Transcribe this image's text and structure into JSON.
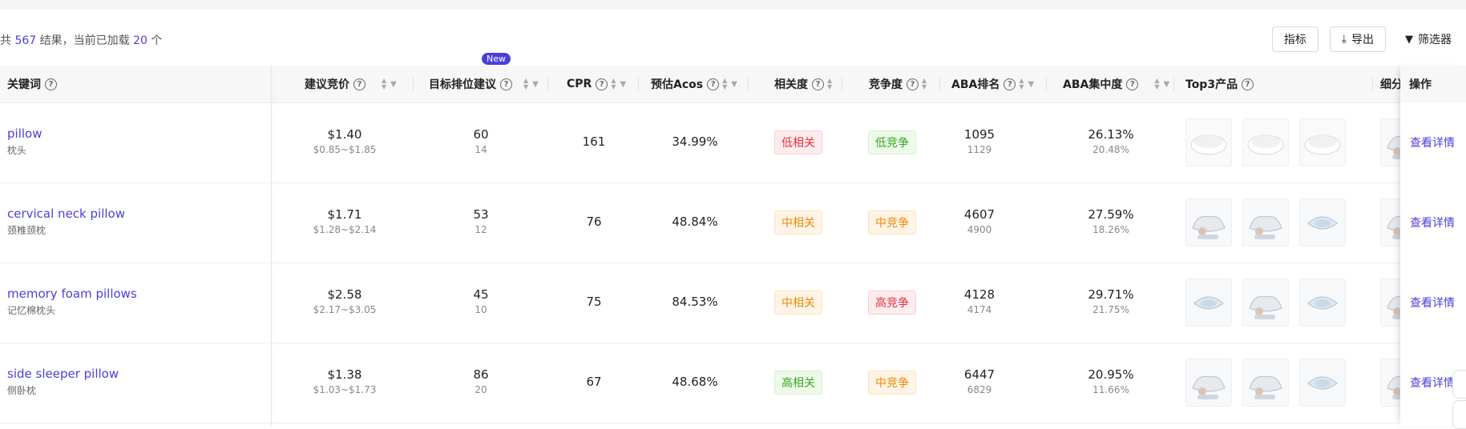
{
  "summary": {
    "prefix": "共",
    "total": "567",
    "middle": "结果，当前已加载",
    "loaded": "20",
    "suffix": "个"
  },
  "toolbar": {
    "metrics_label": "指标",
    "export_label": "导出",
    "filter_label": "筛选器"
  },
  "columns": {
    "keyword": "关键词",
    "bid": "建议竞价",
    "target_rank": "目标排位建议",
    "new_badge": "New",
    "cpr": "CPR",
    "acos": "预估Acos",
    "relevance": "相关度",
    "competition": "竞争度",
    "aba_rank": "ABA排名",
    "aba_conc": "ABA集中度",
    "top3": "Top3产品",
    "segment": "细分",
    "action": "操作"
  },
  "rows": [
    {
      "kw_en": "pillow",
      "kw_cn": "枕头",
      "bid": "$1.40",
      "bid_range": "$0.85~$1.85",
      "rank": "60",
      "rank_sub": "14",
      "cpr": "161",
      "acos": "34.99%",
      "relevance": "低相关",
      "relevance_level": "low-rel",
      "competition": "低竞争",
      "competition_level": "low-comp",
      "aba": "1095",
      "aba_sub": "1129",
      "conc": "26.13%",
      "conc_sub": "20.48%",
      "action": "查看详情"
    },
    {
      "kw_en": "cervical neck pillow",
      "kw_cn": "颈椎颈枕",
      "bid": "$1.71",
      "bid_range": "$1.28~$2.14",
      "rank": "53",
      "rank_sub": "12",
      "cpr": "76",
      "acos": "48.84%",
      "relevance": "中相关",
      "relevance_level": "mid-rel",
      "competition": "中竞争",
      "competition_level": "mid-comp",
      "aba": "4607",
      "aba_sub": "4900",
      "conc": "27.59%",
      "conc_sub": "18.26%",
      "action": "查看详情"
    },
    {
      "kw_en": "memory foam pillows",
      "kw_cn": "记忆棉枕头",
      "bid": "$2.58",
      "bid_range": "$2.17~$3.05",
      "rank": "45",
      "rank_sub": "10",
      "cpr": "75",
      "acos": "84.53%",
      "relevance": "中相关",
      "relevance_level": "mid-rel",
      "competition": "高竞争",
      "competition_level": "high-comp",
      "aba": "4128",
      "aba_sub": "4174",
      "conc": "29.71%",
      "conc_sub": "21.75%",
      "action": "查看详情"
    },
    {
      "kw_en": "side sleeper pillow",
      "kw_cn": "侧卧枕",
      "bid": "$1.38",
      "bid_range": "$1.03~$1.73",
      "rank": "86",
      "rank_sub": "20",
      "cpr": "67",
      "acos": "48.68%",
      "relevance": "高相关",
      "relevance_level": "high-rel",
      "competition": "中竞争",
      "competition_level": "mid-comp",
      "aba": "6447",
      "aba_sub": "6829",
      "conc": "20.95%",
      "conc_sub": "11.66%",
      "action": "查看详情"
    }
  ],
  "colors": {
    "accent": "#4a3fd8",
    "red": "#e5323e",
    "orange": "#f0870a",
    "green": "#34a91b"
  }
}
